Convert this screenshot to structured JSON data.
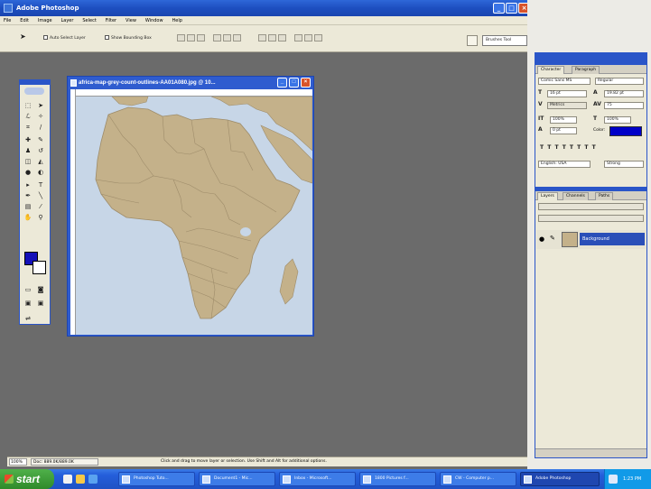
{
  "app": {
    "title": "Adobe Photoshop",
    "window_buttons": [
      "_",
      "□",
      "×"
    ]
  },
  "menu": [
    "File",
    "Edit",
    "Image",
    "Layer",
    "Select",
    "Filter",
    "View",
    "Window",
    "Help"
  ],
  "options_bar": {
    "auto_select_label": "Auto Select Layer",
    "bounding_box_label": "Show Bounding Box",
    "workspace_label": "Brushes  Tool"
  },
  "document": {
    "title": "africa-map-grey-count-outlines-AA01A080.jpg @ 10..."
  },
  "status_bar": {
    "zoom": "100%",
    "doc_size": "Doc: 889.0K/889.0K",
    "hint": "Click and drag to move layer or selection.  Use Shift and Alt for additional options."
  },
  "character_panel": {
    "tabs": [
      "Character",
      "Paragraph"
    ],
    "font_family": "Comic Sans MS",
    "font_style": "Regular",
    "font_size": "16 pt",
    "leading": "19.82 pt",
    "kerning": "Metrics",
    "tracking": "75",
    "vert_scale": "100%",
    "horiz_scale": "100%",
    "baseline": "0 pt",
    "color_label": "Color:",
    "language": "English: USA",
    "antialias": "Strong",
    "color": "#0000c8"
  },
  "layers_panel": {
    "tabs": [
      "Layers",
      "Channels",
      "Paths"
    ],
    "layer_name": "Background"
  },
  "taskbar": {
    "start": "start",
    "tasks": [
      "Photoshop Tuto...",
      "Document1 - Mic...",
      "Inbox - Microsoft...",
      "1800 Pictures f...",
      "CW - Computer p...",
      "Adobe Photoshop"
    ],
    "clock": "1:23 PM"
  },
  "colors": {
    "foreground": "#1410b8",
    "background": "#ffffff",
    "land": "#c4b18a",
    "sea": "#c7d6e7",
    "titlebar_blue": "#2e67d8"
  }
}
